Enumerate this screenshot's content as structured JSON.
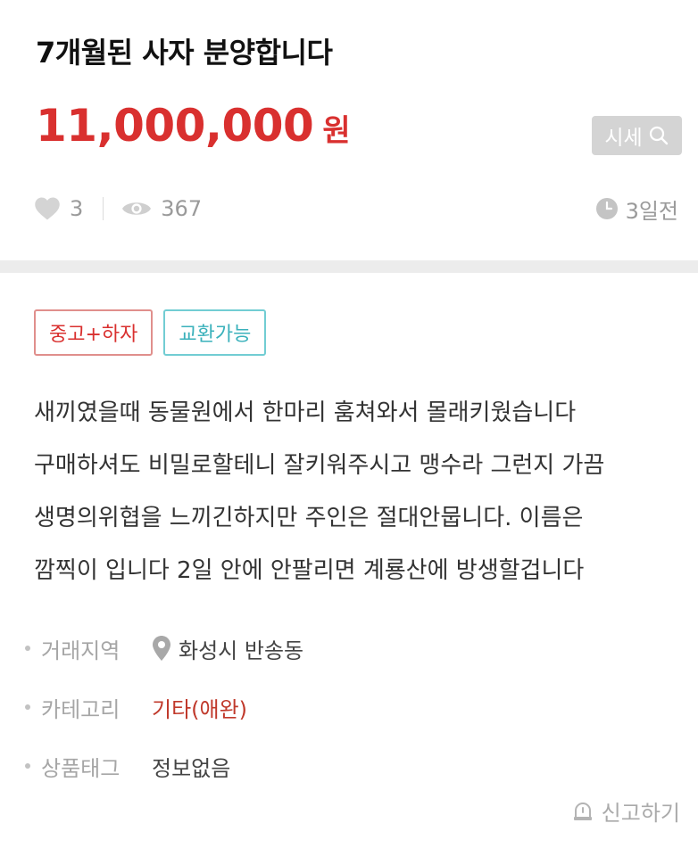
{
  "product": {
    "title": "7개월된  사자 분양합니다",
    "price_amount": "11,000,000",
    "price_unit": "원",
    "market_price_label": "시세",
    "likes": "3",
    "views": "367",
    "posted_ago": "3일전"
  },
  "tags": [
    {
      "label": "중고+하자"
    },
    {
      "label": "교환가능"
    }
  ],
  "description": [
    "새끼였을때 동물원에서 한마리 훔쳐와서 몰래키웠습니다",
    "구매하셔도 비밀로할테니 잘키워주시고 맹수라 그런지 가끔",
    "생명의위협을 느끼긴하지만 주인은 절대안뭅니다. 이름은",
    "깜찍이 입니다 2일 안에 안팔리면 계룡산에 방생할겁니다"
  ],
  "info": {
    "location_label": "거래지역",
    "location_value": "화성시 반송동",
    "category_label": "카테고리",
    "category_value": "기타(애완)",
    "tags_label": "상품태그",
    "tags_value": "정보없음"
  },
  "report_label": "신고하기",
  "icons": [
    "heart-icon",
    "eye-icon",
    "clock-icon",
    "search-icon",
    "location-pin-icon",
    "report-icon"
  ],
  "colors": {
    "price": "#d9302f",
    "tag_red": "#d9302f",
    "tag_teal": "#3ab1bb",
    "category_value": "#c0392b",
    "muted": "#9a9a9a"
  }
}
